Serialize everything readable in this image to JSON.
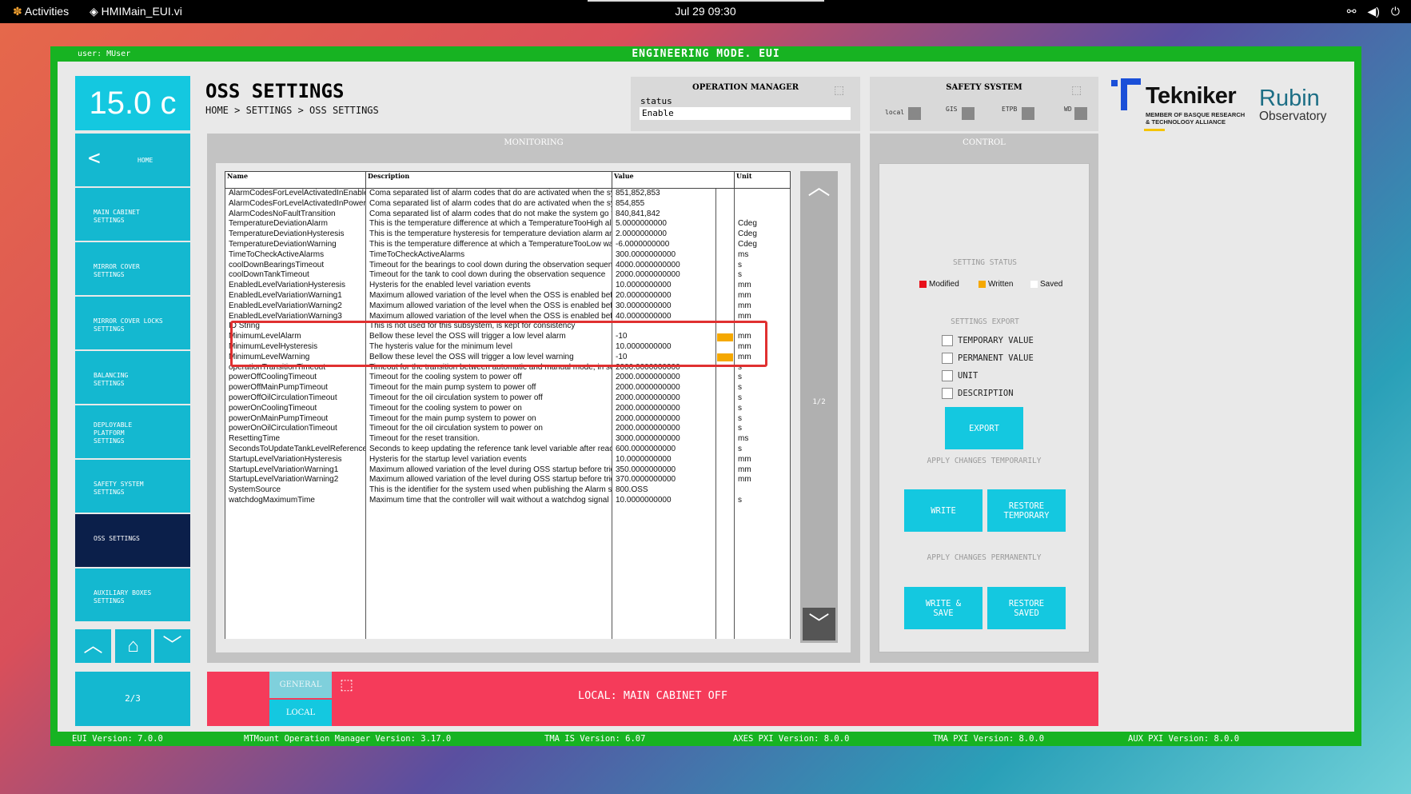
{
  "system": {
    "activities": "Activities",
    "app_name": "HMIMain_EUI.vi",
    "clock": "Jul 29  09:30"
  },
  "window": {
    "user": "user: MUser",
    "mode": "ENGINEERING MODE. EUI"
  },
  "footer": {
    "eui": "EUI Version: 7.0.0",
    "mtmount": "MTMount Operation Manager Version: 3.17.0",
    "tma_is": "TMA IS Version: 6.07",
    "axes": "AXES PXI Version: 8.0.0",
    "tma_pxi": "TMA PXI Version: 8.0.0",
    "aux": "AUX PXI Version: 8.0.0"
  },
  "temperature": "15.0 c",
  "sidebar": {
    "home": "HOME",
    "items": [
      {
        "label": "MAIN CABINET SETTINGS"
      },
      {
        "label": "MIRROR COVER SETTINGS"
      },
      {
        "label": "MIRROR COVER LOCKS SETTINGS"
      },
      {
        "label": "BALANCING SETTINGS"
      },
      {
        "label": "DEPLOYABLE PLATFORM SETTINGS"
      },
      {
        "label": "SAFETY SYSTEM SETTINGS"
      },
      {
        "label": "OSS SETTINGS"
      },
      {
        "label": "AUXILIARY BOXES SETTINGS"
      }
    ],
    "page": "2/3"
  },
  "page": {
    "title": "OSS SETTINGS",
    "breadcrumb": "HOME > SETTINGS > OSS SETTINGS"
  },
  "operation_manager": {
    "title": "OPERATION MANAGER",
    "status_label": "status",
    "status_value": "Enable"
  },
  "safety_system": {
    "title": "SAFETY SYSTEM",
    "items": [
      "local",
      "GIS",
      "ETPB",
      "WD"
    ]
  },
  "logos": {
    "tekniker": "Tekniker",
    "tekniker_sub1": "MEMBER OF BASQUE RESEARCH",
    "tekniker_sub2": "& TECHNOLOGY ALLIANCE",
    "rubin1": "Rubin",
    "rubin2": "Observatory"
  },
  "monitoring": {
    "title": "MONITORING",
    "columns": [
      "Name",
      "Description",
      "Value",
      "Unit"
    ],
    "page": "1/2",
    "rows": [
      {
        "name": "AlarmCodesForLevelActivatedInEnable",
        "desc": "Coma separated list of alarm codes that do are activated when the system",
        "value": "851,852,853",
        "unit": "",
        "flag": false
      },
      {
        "name": "AlarmCodesForLevelActivatedInPowering",
        "desc": "Coma separated list of alarm codes that do are activated when the system",
        "value": "854,855",
        "unit": "",
        "flag": false
      },
      {
        "name": "AlarmCodesNoFaultTransition",
        "desc": "Coma separated list of alarm codes that do not make the system go to fault",
        "value": "840,841,842",
        "unit": "",
        "flag": false
      },
      {
        "name": "TemperatureDeviationAlarm",
        "desc": "This is the temperature difference at which a TemperatureTooHigh alarm",
        "value": "5.0000000000",
        "unit": "Cdeg",
        "flag": false
      },
      {
        "name": "TemperatureDeviationHysteresis",
        "desc": "This is the temperature hysteresis for temperature deviation alarm and",
        "value": "2.0000000000",
        "unit": "Cdeg",
        "flag": false
      },
      {
        "name": "TemperatureDeviationWarning",
        "desc": "This is the temperature difference at which a TemperatureTooLow warning",
        "value": "-6.0000000000",
        "unit": "Cdeg",
        "flag": false
      },
      {
        "name": "TimeToCheckActiveAlarms",
        "desc": "TimeToCheckActiveAlarms",
        "value": "300.0000000000",
        "unit": "ms",
        "flag": false
      },
      {
        "name": "coolDownBearingsTimeout",
        "desc": "Timeout for the bearings to cool down during the observation sequence",
        "value": "4000.0000000000",
        "unit": "s",
        "flag": false
      },
      {
        "name": "coolDownTankTimeout",
        "desc": "Timeout for the tank to cool down during the observation sequence",
        "value": "2000.0000000000",
        "unit": "s",
        "flag": false
      },
      {
        "name": "EnabledLevelVariationHysteresis",
        "desc": "Hysteris for the enabled level variation events",
        "value": "10.0000000000",
        "unit": "mm",
        "flag": false
      },
      {
        "name": "EnabledLevelVariationWarning1",
        "desc": "Maximum allowed variation of the level when the OSS is enabled before",
        "value": "20.0000000000",
        "unit": "mm",
        "flag": false
      },
      {
        "name": "EnabledLevelVariationWarning2",
        "desc": "Maximum allowed variation of the level when the OSS is enabled before",
        "value": "30.0000000000",
        "unit": "mm",
        "flag": false
      },
      {
        "name": "EnabledLevelVariationWarning3",
        "desc": "Maximum allowed variation of the level when the OSS is enabled before",
        "value": "40.0000000000",
        "unit": "mm",
        "flag": false
      },
      {
        "name": "ID String",
        "desc": "This is not used for this subsystem, is kept for consistency",
        "value": "",
        "unit": "",
        "flag": false
      },
      {
        "name": "MinimumLevelAlarm",
        "desc": "Bellow these level the OSS will trigger a low level alarm",
        "value": "-10",
        "unit": "mm",
        "flag": true
      },
      {
        "name": "MinimumLevelHysteresis",
        "desc": "The hysteris value for the minimum level",
        "value": "10.0000000000",
        "unit": "mm",
        "flag": false
      },
      {
        "name": "MinimumLevelWarning",
        "desc": "Bellow these level the OSS will trigger a low level warning",
        "value": "-10",
        "unit": "mm",
        "flag": true
      },
      {
        "name": "operationTransitionTimeout",
        "desc": "Timeout for the transition between automatic and manual mode, in seconds",
        "value": "2000.0000000000",
        "unit": "s",
        "flag": false
      },
      {
        "name": "powerOffCoolingTimeout",
        "desc": "Timeout for the cooling system to power off",
        "value": "2000.0000000000",
        "unit": "s",
        "flag": false
      },
      {
        "name": "powerOffMainPumpTimeout",
        "desc": "Timeout for the main pump system to power off",
        "value": "2000.0000000000",
        "unit": "s",
        "flag": false
      },
      {
        "name": "powerOffOilCirculationTimeout",
        "desc": "Timeout for the oil circulation system to power off",
        "value": "2000.0000000000",
        "unit": "s",
        "flag": false
      },
      {
        "name": "powerOnCoolingTimeout",
        "desc": "Timeout for the cooling system to power on",
        "value": "2000.0000000000",
        "unit": "s",
        "flag": false
      },
      {
        "name": "powerOnMainPumpTimeout",
        "desc": "Timeout for the main pump system to power on",
        "value": "2000.0000000000",
        "unit": "s",
        "flag": false
      },
      {
        "name": "powerOnOilCirculationTimeout",
        "desc": "Timeout for the oil circulation system to power on",
        "value": "2000.0000000000",
        "unit": "s",
        "flag": false
      },
      {
        "name": "ResettingTime",
        "desc": "Timeout for the reset transition.",
        "value": "3000.0000000000",
        "unit": "ms",
        "flag": false
      },
      {
        "name": "SecondsToUpdateTankLevelReference",
        "desc": "Seconds to keep updating the reference tank level variable after reaching",
        "value": "600.0000000000",
        "unit": "s",
        "flag": false
      },
      {
        "name": "StartupLevelVariationHysteresis",
        "desc": "Hysteris for the startup level variation events",
        "value": "10.0000000000",
        "unit": "mm",
        "flag": false
      },
      {
        "name": "StartupLevelVariationWarning1",
        "desc": "Maximum allowed variation of the level during OSS startup before trigger",
        "value": "350.0000000000",
        "unit": "mm",
        "flag": false
      },
      {
        "name": "StartupLevelVariationWarning2",
        "desc": "Maximum allowed variation of the level during OSS startup before trigger",
        "value": "370.0000000000",
        "unit": "mm",
        "flag": false
      },
      {
        "name": "SystemSource",
        "desc": "This is the identifier for the system used when publishing the Alarm source",
        "value": "800.OSS",
        "unit": "",
        "flag": false
      },
      {
        "name": "watchdogMaximumTime",
        "desc": "Maximum time that the controller will wait without a watchdog signal",
        "value": "10.0000000000",
        "unit": "s",
        "flag": false
      }
    ],
    "empty_rows": 13
  },
  "control": {
    "title": "CONTROL",
    "setting_status": "SETTING STATUS",
    "legend": [
      {
        "label": "Modified",
        "color": "#e8101a"
      },
      {
        "label": "Written",
        "color": "#f5a800"
      },
      {
        "label": "Saved",
        "color": "#ffffff"
      }
    ],
    "settings_export": "SETTINGS EXPORT",
    "checks": [
      "TEMPORARY VALUE",
      "PERMANENT VALUE",
      "UNIT",
      "DESCRIPTION"
    ],
    "export": "EXPORT",
    "apply_temp": "APPLY CHANGES TEMPORARILY",
    "write": "WRITE",
    "restore_temp": "RESTORE TEMPORARY",
    "apply_perm": "APPLY CHANGES PERMANENTLY",
    "write_save": "WRITE & SAVE",
    "restore_saved": "RESTORE SAVED"
  },
  "alarm": {
    "tab_general": "GENERAL",
    "tab_local": "LOCAL",
    "message": "LOCAL: MAIN CABINET OFF"
  },
  "colors": {
    "frame": "#17b322",
    "accent": "#14c8e0",
    "alarm": "#f53b5a",
    "nav_active": "#0b1f4a"
  }
}
